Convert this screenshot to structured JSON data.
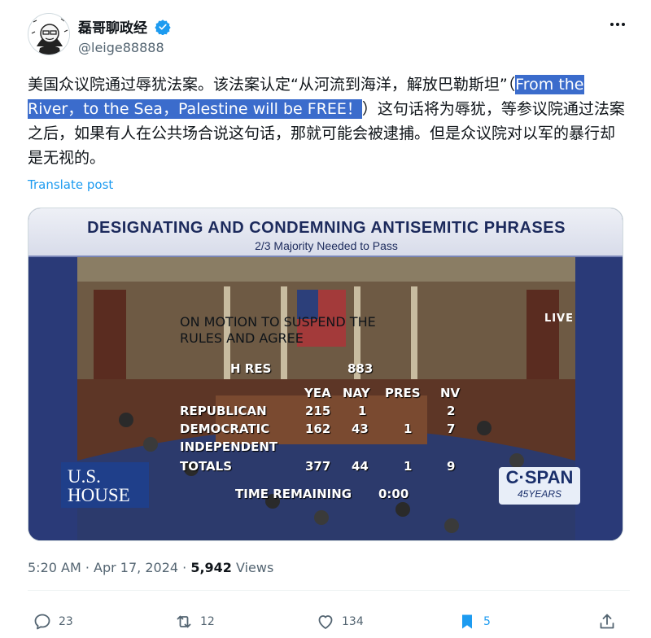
{
  "author": {
    "display_name": "磊哥聊政经",
    "handle": "@leige88888"
  },
  "post": {
    "text_before": "美国众议院通过辱犹法案。该法案认定“从河流到海洋，解放巴勒斯坦”（",
    "text_highlight": "From the River，to the Sea，Palestine will be FREE！",
    "text_after": "）这句话将为辱犹，等参议院通过法案之后，如果有人在公共场合说这句话，那就可能会被逮捕。但是众议院对以军的暴行却是无视的。",
    "translate_label": "Translate post"
  },
  "media": {
    "banner_title": "DESIGNATING AND CONDEMNING ANTISEMITIC PHRASES",
    "banner_subtitle": "2/3 Majority Needed to Pass",
    "live_label": "LIVE",
    "motion_line1": "ON MOTION TO SUSPEND THE",
    "motion_line2": "RULES AND AGREE",
    "bill_label": "H RES",
    "bill_number": "883",
    "vote_headers": [
      "YEA",
      "NAY",
      "PRES",
      "NV"
    ],
    "vote_rows": [
      {
        "party": "REPUBLICAN",
        "yea": "215",
        "nay": "1",
        "pres": "",
        "nv": "2"
      },
      {
        "party": "DEMOCRATIC",
        "yea": "162",
        "nay": "43",
        "pres": "1",
        "nv": "7"
      },
      {
        "party": "INDEPENDENT",
        "yea": "",
        "nay": "",
        "pres": "",
        "nv": ""
      },
      {
        "party": "TOTALS",
        "yea": "377",
        "nay": "44",
        "pres": "1",
        "nv": "9"
      }
    ],
    "time_label": "TIME REMAINING",
    "time_value": "0:00",
    "ushouse_line1": "U.S.",
    "ushouse_line2": "HOUSE",
    "cspan_name": "C·SPAN",
    "cspan_sub": "45YEARS"
  },
  "meta": {
    "time": "5:20 AM",
    "separator": " · ",
    "date": "Apr 17, 2024",
    "views_count": "5,942",
    "views_label": " Views"
  },
  "actions": {
    "replies": "23",
    "reposts": "12",
    "likes": "134",
    "bookmarks": "5"
  },
  "colors": {
    "accent": "#1d9bf0",
    "highlight": "#3b6ccc",
    "text": "#0f1419",
    "muted": "#536471"
  }
}
